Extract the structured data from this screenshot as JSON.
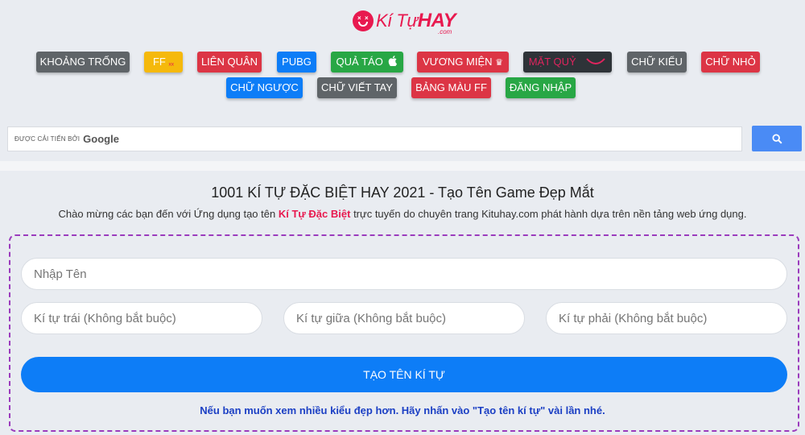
{
  "logo": {
    "text_part1": "Kí Tự",
    "text_part2": "HAY",
    "suffix": ".com"
  },
  "nav": {
    "row1": [
      {
        "label": "KHOẢNG TRỐNG",
        "color": "#5f6468"
      },
      {
        "label": "FF",
        "icon_text": "ₓₓ",
        "color": "#f5b90c"
      },
      {
        "label": "LIÊN QUÂN",
        "color": "#dc3545"
      },
      {
        "label": "PUBG",
        "color": "#0d7df7"
      },
      {
        "label": "QUẢ TÁO",
        "icon": "apple-icon",
        "color": "#28a745"
      },
      {
        "label": "VƯƠNG MIỆN",
        "icon_text": "♛",
        "color": "#dc3545"
      },
      {
        "label": "MẶT QUỶ",
        "icon_text": "◡̈",
        "color": "#2e3338"
      },
      {
        "label": "CHỮ KIỂU",
        "color": "#5f6468"
      },
      {
        "label": "CHỮ NHỎ",
        "color": "#dc3545"
      }
    ],
    "row2": [
      {
        "label": "CHỮ NGƯỢC",
        "color": "#0d7df7"
      },
      {
        "label": "CHỮ VIẾT TAY",
        "color": "#5f6468"
      },
      {
        "label": "BẢNG MÀU FF",
        "color": "#dc3545"
      },
      {
        "label": "ĐĂNG NHẬP",
        "color": "#28a745"
      }
    ]
  },
  "search": {
    "powered_by": "ĐƯỢC CẢI TIẾN BỞI",
    "brand": "Google",
    "button_icon": "search-icon"
  },
  "main": {
    "title": "1001 KÍ TỰ ĐẶC BIỆT HAY 2021 - Tạo Tên Game Đẹp Mắt",
    "intro_before": "Chào mừng các bạn đến với Ứng dụng tạo tên ",
    "intro_highlight": "Kí Tự Đặc Biệt",
    "intro_after": " trực tuyến do chuyên trang Kituhay.com phát hành dựa trên nền tảng web ứng dụng."
  },
  "form": {
    "name_placeholder": "Nhập Tên",
    "left_placeholder": "Kí tự trái (Không bắt buộc)",
    "middle_placeholder": "Kí tự giữa (Không bắt buộc)",
    "right_placeholder": "Kí tự phải (Không bắt buộc)",
    "submit_label": "TẠO TÊN KÍ TỰ",
    "hint": "Nếu bạn muốn xem nhiều kiểu đẹp hơn. Hãy nhấn vào \"Tạo tên kí tự\" vài lần nhé."
  }
}
